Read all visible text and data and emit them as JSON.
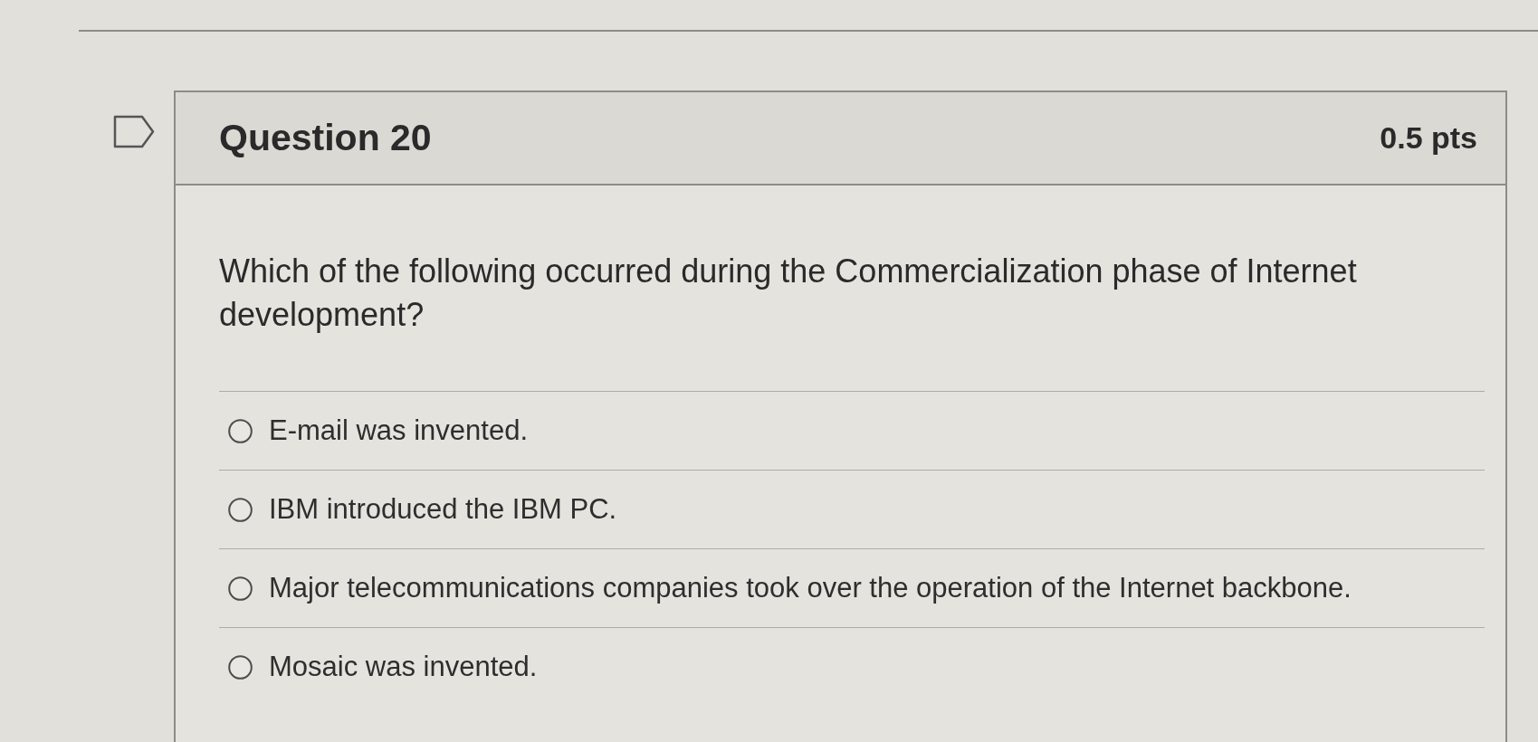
{
  "question": {
    "flagged": false,
    "title": "Question 20",
    "points": "0.5 pts",
    "text": "Which of the following occurred during the Commercialization phase of Internet development?",
    "answers": [
      {
        "label": "E-mail was invented.",
        "selected": false
      },
      {
        "label": "IBM introduced the IBM PC.",
        "selected": false
      },
      {
        "label": "Major telecommunications companies took over the operation of the Internet backbone.",
        "selected": false
      },
      {
        "label": "Mosaic was invented.",
        "selected": false
      }
    ]
  }
}
